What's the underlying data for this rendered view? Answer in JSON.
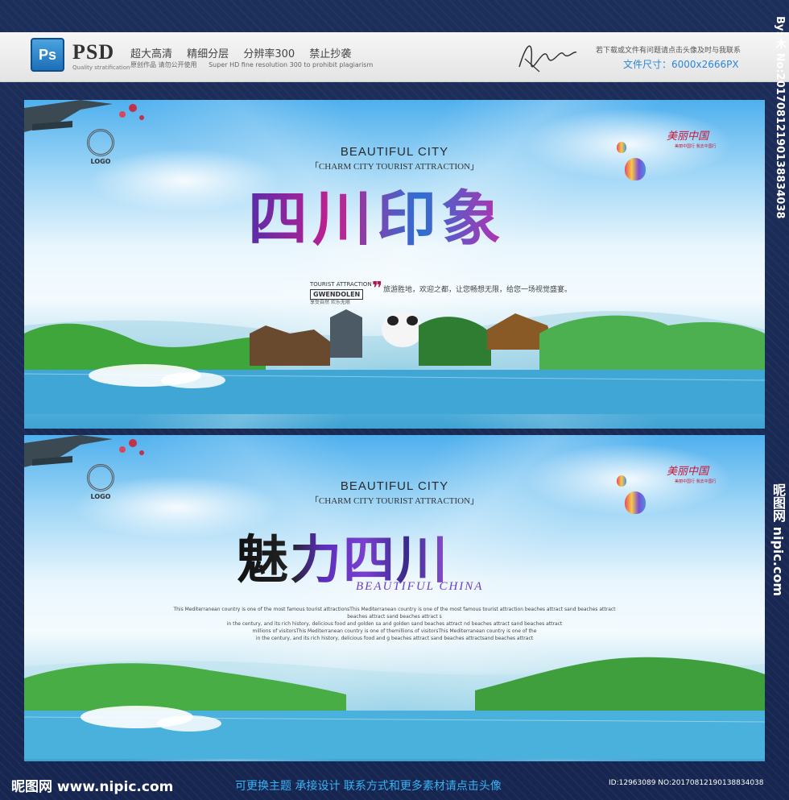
{
  "header": {
    "ps_badge": "Ps",
    "psd_label": "PSD",
    "psd_sub": "Quality stratification",
    "features": [
      "超大高清",
      "精细分层",
      "分辨率300",
      "禁止抄袭"
    ],
    "features_sub": [
      "原创作品 请勿公开使用",
      "Super HD  fine resolution 300  to prohibit  plagiarism"
    ],
    "notice": "若下载或文件有问题请点击头像及时与我联系",
    "file_size": "文件尺寸：6000x2666PX"
  },
  "watermark_vertical": "By: 木 No:20170812190138834038",
  "watermark_vertical2": "昵图网 nipic.com",
  "poster1": {
    "logo": "LOGO",
    "beautiful_city": "BEAUTIFUL CITY",
    "charm_city": "「CHARM CITY TOURIST ATTRACTION」",
    "title": "四川印象",
    "gwendolen_top": "TOURIST ATTRACTION",
    "gwendolen": "GWENDOLEN",
    "gwendolen_sub": "享受自然 欢乐无限",
    "slogan": "旅游胜地，欢迎之都，让您畅想无限，给您一场视觉盛宴。",
    "meili_china": "美丽中国",
    "meili_sub": "美丽中国行  我去中国行"
  },
  "poster2": {
    "logo": "LOGO",
    "beautiful_city": "BEAUTIFUL CITY",
    "charm_city": "「CHARM CITY TOURIST ATTRACTION」",
    "title": "魅力四川",
    "subtitle": "BEAUTIFUL CHINA",
    "body_lines": [
      "This Mediterranean country is one of the most famous tourist attractionsThis Mediterranean country is one of the most famous tourist attraction beaches attract sand beaches attract  beaches attract sand beaches attract s",
      "in the century, and its rich history, delicious food and golden sa and golden sand beaches attract nd beaches attract sand beaches attract",
      "millions of visitorsThis Mediterranean country is one of themillions of visitorsThis Mediterranean country is one of the",
      "in the century, and its rich history, delicious food and g beaches attract sand beaches attractsand beaches attract"
    ],
    "meili_china": "美丽中国",
    "meili_sub": "美丽中国行  我去中国行"
  },
  "footer": {
    "site": "昵图网 www.nipic.com",
    "promo": "可更换主题  承接设计  联系方式和更多素材请点击头像",
    "id": "ID:12963089 NO:20170812190138834038"
  },
  "colors": {
    "frame": "#1b2c55",
    "title1_gradient": [
      "#5a2ca8",
      "#c51f8f",
      "#2d6fd3"
    ],
    "title2_accent": "#6a3fd0",
    "footer_accent": "#36b3f5",
    "meili_red": "#c7173a"
  }
}
